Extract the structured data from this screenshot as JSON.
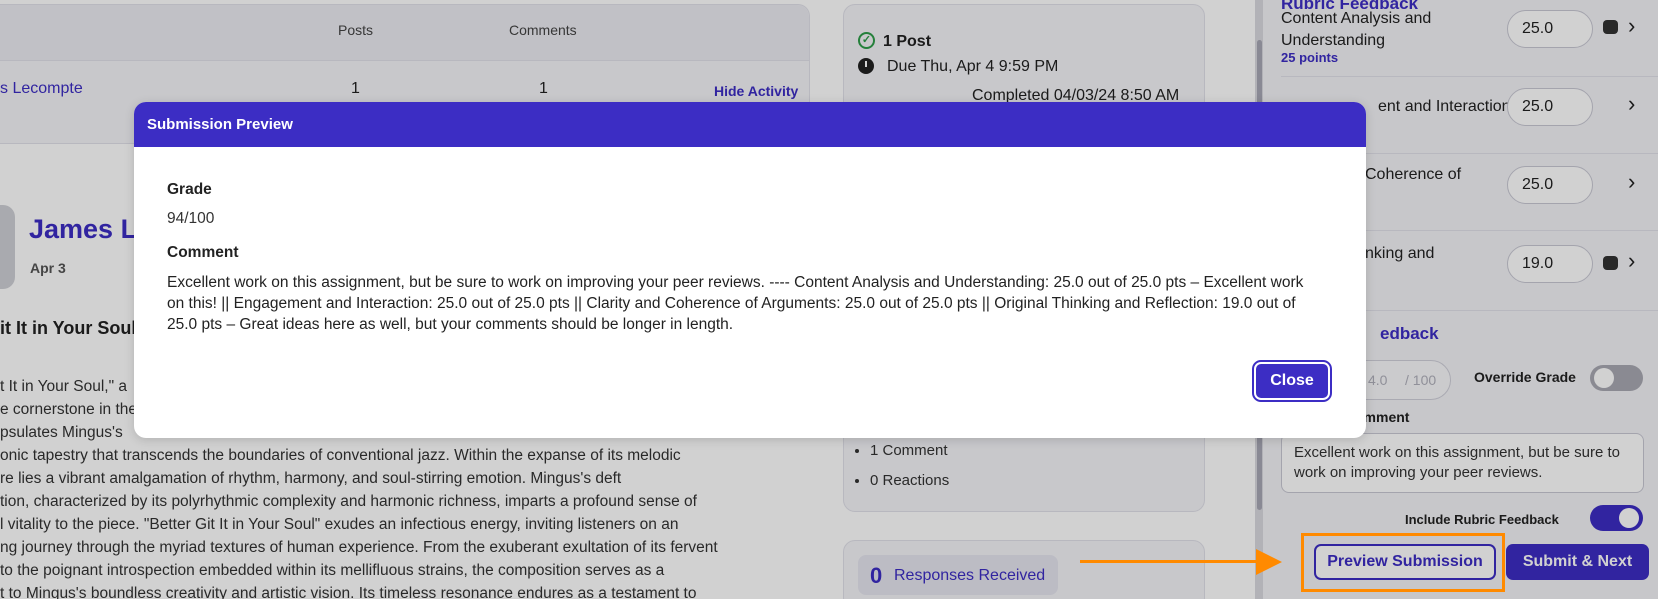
{
  "activity_table": {
    "col_posts": "Posts",
    "col_comments": "Comments",
    "row": {
      "student": "s Lecompte",
      "posts": "1",
      "comments": "1",
      "action": "Hide Activity"
    }
  },
  "post": {
    "author": "James L",
    "date": "Apr 3",
    "title": "it It in Your Soul",
    "body_lines": [
      "t It in Your Soul,\" a",
      "e cornerstone in the",
      "psulates Mingus's",
      "onic tapestry that transcends the boundaries of conventional jazz. Within the expanse of its melodic",
      "re lies a vibrant amalgamation of rhythm, harmony, and soul-stirring emotion. Mingus's deft",
      "tion, characterized by its polyrhythmic complexity and harmonic richness, imparts a profound sense of",
      "l vitality to the piece. \"Better Git It in Your Soul\" exudes an infectious energy, inviting listeners on an",
      "ng journey through the myriad textures of human experience. From the exuberant exultation of its fervent",
      " to the poignant introspection embedded within its mellifluous strains, the composition serves as a",
      "t to Mingus's boundless creativity and artistic vision. Its timeless resonance endures as a testament to"
    ]
  },
  "status": {
    "posts": "1 Post",
    "due": "Due Thu, Apr 4 9:59 PM",
    "completed": "Completed 04/03/24 8:50 AM",
    "comments": "1 Comment",
    "reactions": "0 Reactions",
    "responses_count": "0",
    "responses_label": "Responses Received"
  },
  "rubric": {
    "title": "Rubric Feedback",
    "criteria": [
      {
        "label_line1": "Content Analysis and",
        "label_line2": "Understanding",
        "points": "25 points",
        "score": "25.0"
      },
      {
        "label_line1": "ent and Interaction",
        "score": "25.0"
      },
      {
        "label_line1": "Coherence of",
        "score": "25.0"
      },
      {
        "label_line1": "nking and",
        "score": "19.0"
      }
    ]
  },
  "overall": {
    "title": "edback",
    "grade_value": "4.0",
    "grade_max": "/ 100",
    "override_label": "Override Grade",
    "comment_label": "omment",
    "comment_text": "Excellent work on this assignment, but be sure to work on improving your peer reviews.",
    "include_label": "Include Rubric Feedback",
    "preview_button": "Preview Submission",
    "submit_button": "Submit & Next"
  },
  "modal": {
    "title": "Submission Preview",
    "grade_label": "Grade",
    "grade_value": "94/100",
    "comment_label": "Comment",
    "comment_text": "Excellent work on this assignment, but be sure to work on improving your peer reviews. ---- Content Analysis and Understanding: 25.0 out of 25.0 pts – Excellent work on this! || Engagement and Interaction: 25.0 out of 25.0 pts || Clarity and Coherence of Arguments: 25.0 out of 25.0 pts || Original Thinking and Reflection: 19.0 out of 25.0 pts – Great ideas here as well, but your comments should be longer in length.",
    "close_button": "Close"
  },
  "colors": {
    "brand": "#3c2dc4",
    "annotation": "#ff8a00",
    "success": "#2e9d49"
  }
}
